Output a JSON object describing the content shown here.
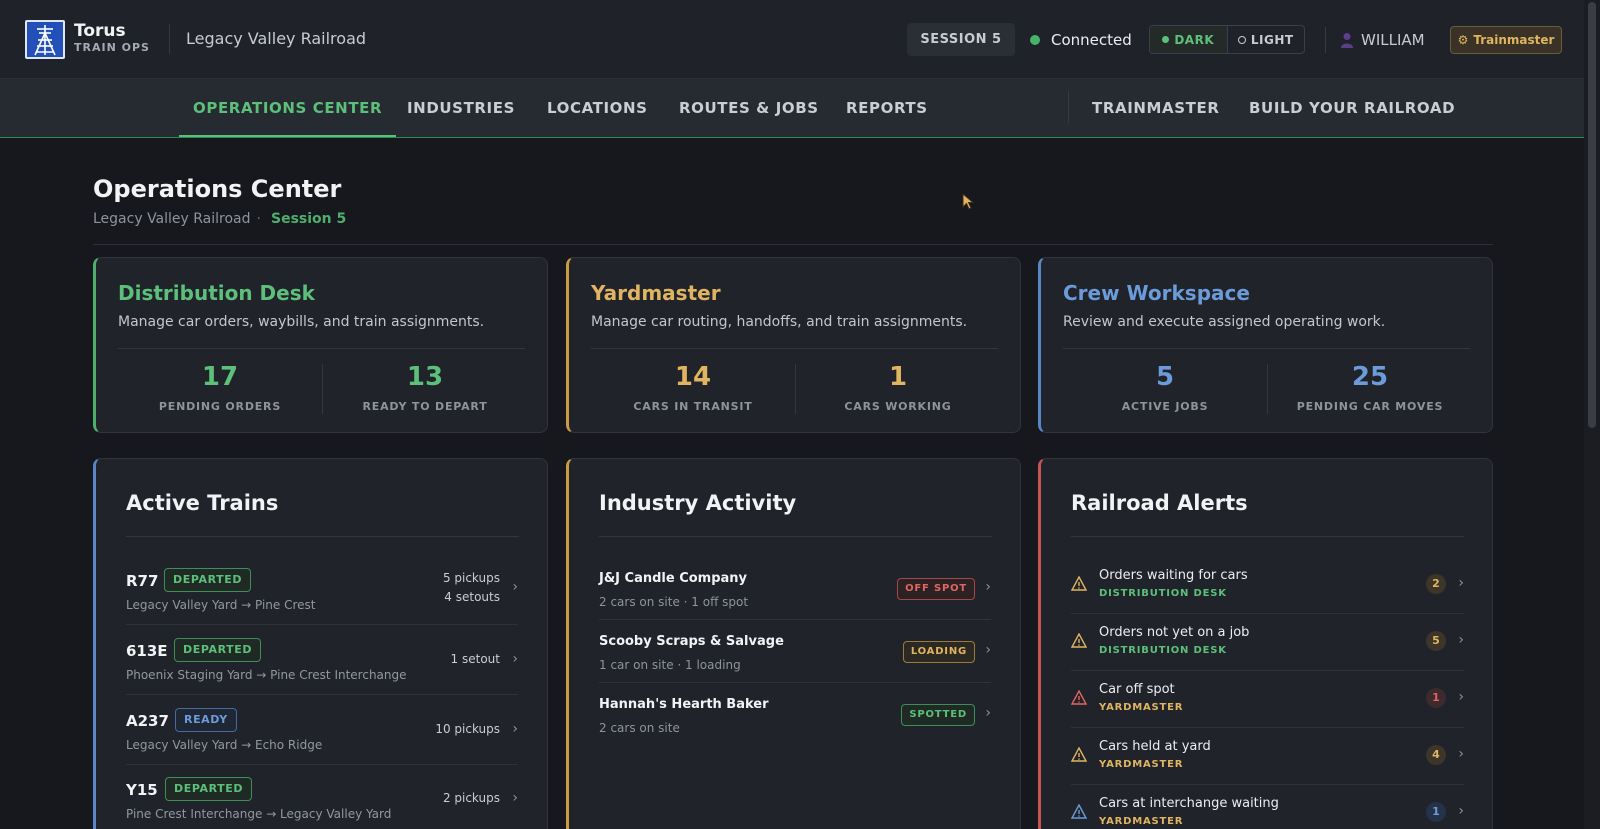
{
  "header": {
    "brand_name": "Torus",
    "brand_sub": "TRAIN OPS",
    "railroad_name": "Legacy Valley Railroad",
    "session_label": "SESSION 5",
    "connection_status": "Connected",
    "theme": {
      "dark_label": "DARK",
      "light_label": "LIGHT",
      "selected": "DARK"
    },
    "user_name": "WILLIAM",
    "role_badge": "Trainmaster",
    "colors": {
      "accent_green": "#5cc07a",
      "accent_amber": "#e0b461",
      "accent_blue": "#6b9bd8",
      "accent_red": "#e06464"
    }
  },
  "nav": {
    "items": [
      {
        "label": "OPERATIONS CENTER",
        "active": true
      },
      {
        "label": "INDUSTRIES"
      },
      {
        "label": "LOCATIONS"
      },
      {
        "label": "ROUTES & JOBS"
      },
      {
        "label": "REPORTS"
      },
      {
        "label": "TRAINMASTER"
      },
      {
        "label": "BUILD YOUR RAILROAD"
      }
    ]
  },
  "page": {
    "title": "Operations Center",
    "railroad": "Legacy Valley Railroad",
    "separator": "·",
    "session": "Session 5"
  },
  "summary_cards": [
    {
      "title": "Distribution Desk",
      "description": "Manage car orders, waybills, and train assignments.",
      "stats": [
        {
          "value": "17",
          "label": "PENDING ORDERS"
        },
        {
          "value": "13",
          "label": "READY TO DEPART"
        }
      ]
    },
    {
      "title": "Yardmaster",
      "description": "Manage car routing, handoffs, and train assignments.",
      "stats": [
        {
          "value": "14",
          "label": "CARS IN TRANSIT"
        },
        {
          "value": "1",
          "label": "CARS WORKING"
        }
      ]
    },
    {
      "title": "Crew Workspace",
      "description": "Review and execute assigned operating work.",
      "stats": [
        {
          "value": "5",
          "label": "ACTIVE JOBS"
        },
        {
          "value": "25",
          "label": "PENDING CAR MOVES"
        }
      ]
    }
  ],
  "active_trains": {
    "title": "Active Trains",
    "trains": [
      {
        "id": "R77",
        "status": "DEPARTED",
        "route": "Legacy Valley Yard → Pine Crest",
        "moves": [
          "5 pickups",
          "4 setouts"
        ]
      },
      {
        "id": "613E",
        "status": "DEPARTED",
        "route": "Phoenix Staging Yard → Pine Crest Interchange",
        "moves": [
          "1 setout"
        ]
      },
      {
        "id": "A237",
        "status": "READY",
        "route": "Legacy Valley Yard → Echo Ridge",
        "moves": [
          "10 pickups"
        ]
      },
      {
        "id": "Y15",
        "status": "DEPARTED",
        "route": "Pine Crest Interchange → Legacy Valley Yard",
        "moves": [
          "2 pickups"
        ]
      }
    ]
  },
  "industry_activity": {
    "title": "Industry Activity",
    "industries": [
      {
        "name": "J&J Candle Company",
        "detail": "2 cars on site · 1 off spot",
        "status": "OFF SPOT"
      },
      {
        "name": "Scooby Scraps & Salvage",
        "detail": "1 car on site · 1 loading",
        "status": "LOADING"
      },
      {
        "name": "Hannah's Hearth Baker",
        "detail": "2 cars on site",
        "status": "SPOTTED"
      }
    ]
  },
  "railroad_alerts": {
    "title": "Railroad Alerts",
    "alerts": [
      {
        "text": "Orders waiting for cars",
        "dept": "DISTRIBUTION DESK",
        "count": "2",
        "icon": "warning-icon"
      },
      {
        "text": "Orders not yet on a job",
        "dept": "DISTRIBUTION DESK",
        "count": "5",
        "icon": "warning-icon"
      },
      {
        "text": "Car off spot",
        "dept": "YARDMASTER",
        "count": "1",
        "icon": "warning-icon"
      },
      {
        "text": "Cars held at yard",
        "dept": "YARDMASTER",
        "count": "4",
        "icon": "warning-icon"
      },
      {
        "text": "Cars at interchange waiting",
        "dept": "YARDMASTER",
        "count": "1",
        "icon": "warning-icon"
      }
    ]
  }
}
